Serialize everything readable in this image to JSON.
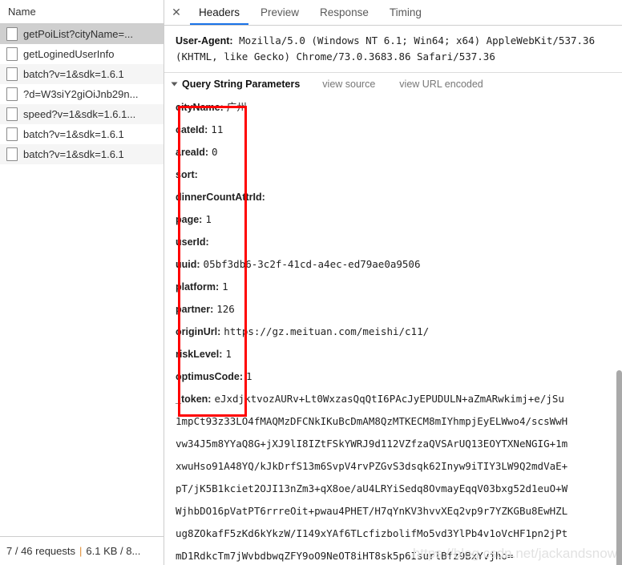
{
  "sidebar": {
    "column_header": "Name",
    "requests": [
      {
        "name": "getPoiList?cityName=...",
        "selected": true
      },
      {
        "name": "getLoginedUserInfo",
        "selected": false
      },
      {
        "name": "batch?v=1&sdk=1.6.1",
        "selected": false
      },
      {
        "name": "?d=W3siY2giOiJnb29n...",
        "selected": false
      },
      {
        "name": "speed?v=1&sdk=1.6.1...",
        "selected": false
      },
      {
        "name": "batch?v=1&sdk=1.6.1",
        "selected": false
      },
      {
        "name": "batch?v=1&sdk=1.6.1",
        "selected": false
      }
    ],
    "status": {
      "requests": "7 / 46 requests",
      "separator": "|",
      "size": "6.1 KB / 8..."
    }
  },
  "tabs": {
    "close_label": "✕",
    "items": [
      {
        "label": "Headers",
        "active": true
      },
      {
        "label": "Preview",
        "active": false
      },
      {
        "label": "Response",
        "active": false
      },
      {
        "label": "Timing",
        "active": false
      }
    ]
  },
  "headers": {
    "user_agent_label": "User-Agent:",
    "user_agent_value": "Mozilla/5.0 (Windows NT 6.1; Win64; x64) AppleWebKit/537.36 (KHTML, like Gecko) Chrome/73.0.3683.86 Safari/537.36"
  },
  "query_section": {
    "title": "Query String Parameters",
    "view_source": "view source",
    "view_url_encoded": "view URL encoded",
    "params": [
      {
        "key": "cityName:",
        "value": "广州"
      },
      {
        "key": "cateId:",
        "value": "11"
      },
      {
        "key": "areaId:",
        "value": "0"
      },
      {
        "key": "sort:",
        "value": ""
      },
      {
        "key": "dinnerCountAttrId:",
        "value": ""
      },
      {
        "key": "page:",
        "value": "1"
      },
      {
        "key": "userId:",
        "value": ""
      },
      {
        "key": "uuid:",
        "value": "05bf3db6-3c2f-41cd-a4ec-ed79ae0a9506"
      },
      {
        "key": "platform:",
        "value": "1"
      },
      {
        "key": "partner:",
        "value": "126"
      },
      {
        "key": "originUrl:",
        "value": "https://gz.meituan.com/meishi/c11/"
      },
      {
        "key": "riskLevel:",
        "value": "1"
      },
      {
        "key": "optimusCode:",
        "value": "1"
      }
    ],
    "token_key": "_token:",
    "token_lines": [
      "eJxdjktvozAURv+Lt0WxzasQqQtI6PAcJyEPUDULN+aZmARwkimj+e/jSu",
      "1mpCt93z33LO4fMAQMzDFCNkIKuBcDmAM8QzMTKECM8mIYhmpjEyELWwo4/scsWwH",
      "vw34J5m8YYaQ8G+jXJ9lI8IZtFSkYWRJ9d112VZfzaQVSArUQ13EOYTXNeNGIG+1m",
      "xwuHso91A48YQ/kJkDrfS13m6SvpV4rvPZGvS3dsqk62Inyw9iTIY3LW9Q2mdVaE+",
      "pT/jK5B1kciet2OJI13nZm3+qX8oe/aU4LRYiSedq8OvmayEqqV03bxg52d1euO+W",
      "WjhbDO16pVatPT6rrreOit+pwau4PHET/H7qYnKV3hvvXEq2vp9r7YZKGBu8EwHZL",
      "ug8ZOkafF5zKd6kYkzW/I149xYAf6TLcfizbolifMo5vd3YlPb4v1oVcHF1pn2jPt",
      "mD1RdkcTm7jWvbdbwqZFY9oO9NeOT8iHT8sk5p6IsurlBfz9BxYvjho="
    ]
  },
  "annotation": {
    "highlight_color": "#ff0000"
  },
  "watermark": {
    "text": "https://blog.csdn.net/jackandsnow"
  }
}
